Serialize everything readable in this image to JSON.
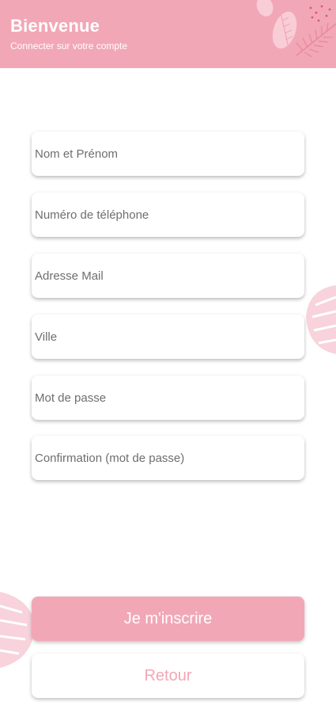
{
  "header": {
    "title": "Bienvenue",
    "subtitle": "Connecter sur votre compte"
  },
  "form": {
    "fields": [
      {
        "placeholder": "Nom et Prénom"
      },
      {
        "placeholder": "Numéro de téléphone"
      },
      {
        "placeholder": "Adresse Mail"
      },
      {
        "placeholder": "Ville"
      },
      {
        "placeholder": "Mot de passe"
      },
      {
        "placeholder": "Confirmation (mot de passe)"
      }
    ]
  },
  "actions": {
    "register_label": "Je m'inscrire",
    "back_label": "Retour"
  },
  "colors": {
    "primary": "#f2a7b6",
    "background": "#ffffff"
  }
}
